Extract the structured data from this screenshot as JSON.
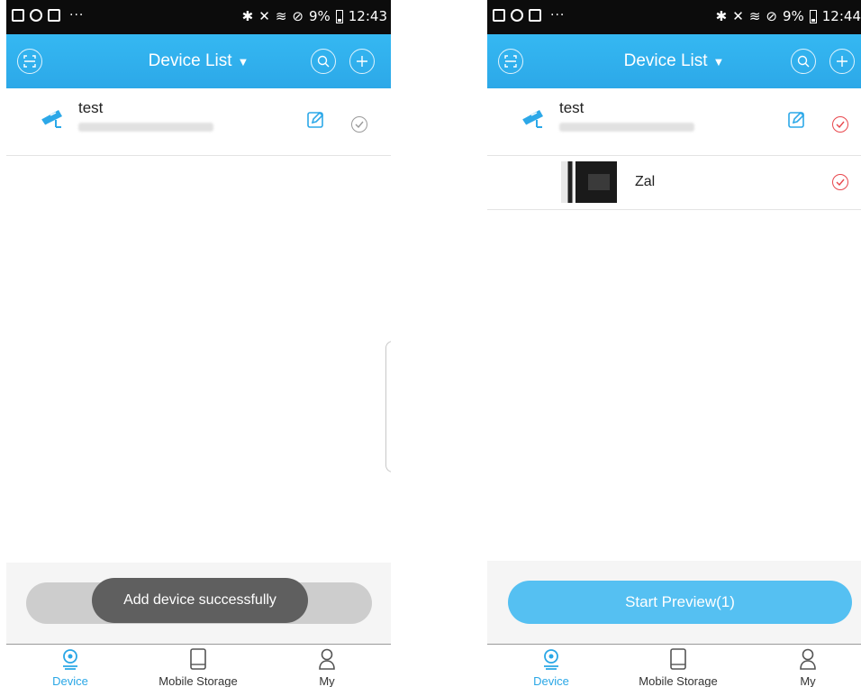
{
  "colors": {
    "accent": "#2ca8e8",
    "danger": "#e8474d",
    "button": "#55c0f2",
    "toast": "#5f5f5f"
  },
  "left_screen": {
    "status": {
      "battery_pct": "9%",
      "time": "12:43"
    },
    "header": {
      "title": "Device List",
      "caret": "▼",
      "scan_icon": "scan-qr-icon",
      "search_icon": "search-icon",
      "add_icon": "plus-icon"
    },
    "devices": [
      {
        "name": "test",
        "checked": false
      }
    ],
    "toast": "Add device successfully",
    "tabs": [
      {
        "label": "Device",
        "icon": "camera-location-icon",
        "active": true
      },
      {
        "label": "Mobile Storage",
        "icon": "tablet-icon",
        "active": false
      },
      {
        "label": "My",
        "icon": "person-icon",
        "active": false
      }
    ]
  },
  "right_screen": {
    "status": {
      "battery_pct": "9%",
      "time": "12:44"
    },
    "header": {
      "title": "Device List",
      "caret": "▼",
      "scan_icon": "scan-qr-icon",
      "search_icon": "search-icon",
      "add_icon": "plus-icon"
    },
    "devices": [
      {
        "name": "test",
        "checked": true
      }
    ],
    "channels": [
      {
        "name": "Zal",
        "checked": true
      }
    ],
    "start_preview": "Start Preview(1)",
    "tabs": [
      {
        "label": "Device",
        "icon": "camera-location-icon",
        "active": true
      },
      {
        "label": "Mobile Storage",
        "icon": "tablet-icon",
        "active": false
      },
      {
        "label": "My",
        "icon": "person-icon",
        "active": false
      }
    ]
  }
}
